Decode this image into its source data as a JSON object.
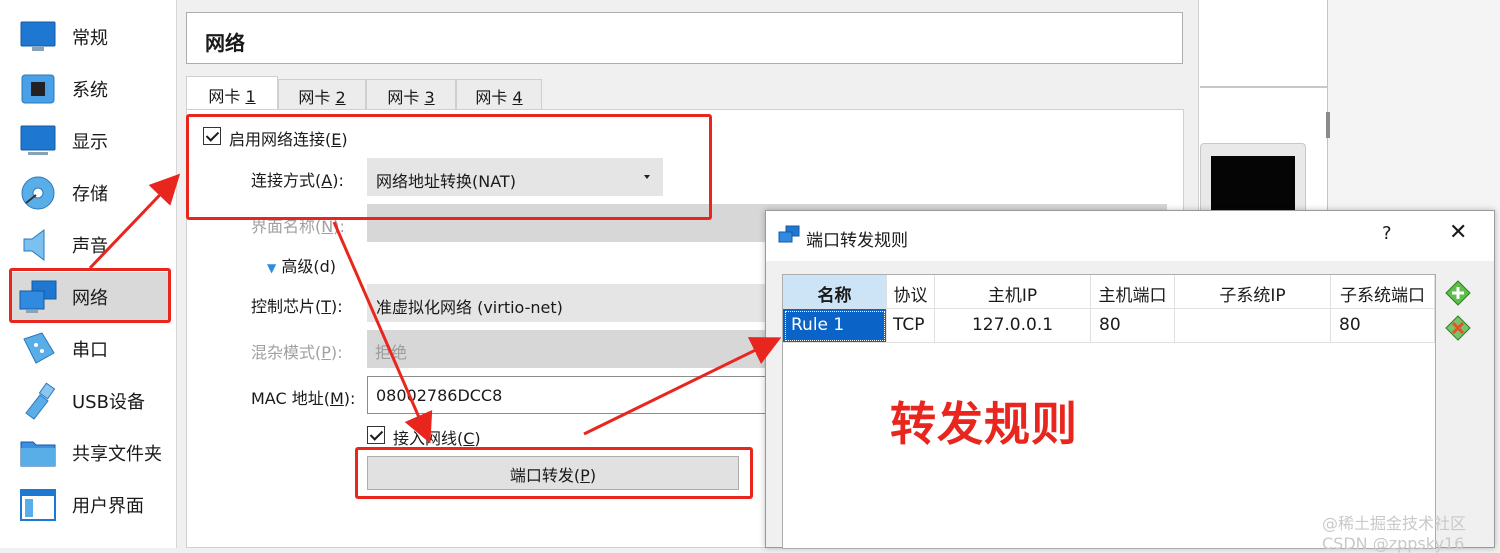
{
  "sidebar": {
    "items": [
      {
        "label": "常规",
        "icon": "general-monitor-icon"
      },
      {
        "label": "系统",
        "icon": "system-chip-icon"
      },
      {
        "label": "显示",
        "icon": "display-monitor-icon"
      },
      {
        "label": "存储",
        "icon": "storage-disk-icon"
      },
      {
        "label": "声音",
        "icon": "speaker-icon"
      },
      {
        "label": "网络",
        "icon": "network-icon",
        "selected": true
      },
      {
        "label": "串口",
        "icon": "serial-port-icon"
      },
      {
        "label": "USB设备",
        "icon": "usb-icon"
      },
      {
        "label": "共享文件夹",
        "icon": "shared-folder-icon"
      },
      {
        "label": "用户界面",
        "icon": "user-interface-icon"
      }
    ]
  },
  "panel": {
    "section_title": "网络",
    "tabs": [
      {
        "prefix": "网卡 ",
        "num": "1",
        "active": true
      },
      {
        "prefix": "网卡 ",
        "num": "2"
      },
      {
        "prefix": "网卡 ",
        "num": "3"
      },
      {
        "prefix": "网卡 ",
        "num": "4"
      }
    ],
    "enable_network": {
      "label": "启用网络连接(",
      "mnemonic": "E",
      "suffix": ")",
      "checked": true
    },
    "attached_to": {
      "label": "连接方式(",
      "mnemonic": "A",
      "suffix": "):",
      "value": "网络地址转换(NAT)"
    },
    "interface_name": {
      "label": "界面名称(",
      "mnemonic": "N",
      "suffix": "):"
    },
    "advanced": {
      "label": "高级(d)"
    },
    "adapter_type": {
      "label": "控制芯片(",
      "mnemonic": "T",
      "suffix": "):",
      "value": "准虚拟化网络 (virtio-net)"
    },
    "promiscuous": {
      "label": "混杂模式(",
      "mnemonic": "P",
      "suffix": "):",
      "value": "拒绝"
    },
    "mac": {
      "label": "MAC 地址(",
      "mnemonic": "M",
      "suffix": "):",
      "value": "08002786DCC8"
    },
    "cable_connected": {
      "label": "接入网线(",
      "mnemonic": "C",
      "suffix": ")",
      "checked": true
    },
    "port_forward_button": {
      "label": "端口转发(",
      "mnemonic": "P",
      "suffix": ")"
    }
  },
  "dialog": {
    "title": "端口转发规则",
    "help": "?",
    "close": "✕",
    "columns": [
      "名称",
      "协议",
      "主机IP",
      "主机端口",
      "子系统IP",
      "子系统端口"
    ],
    "rows": [
      {
        "name": "Rule 1",
        "protocol": "TCP",
        "host_ip": "127.0.0.1",
        "host_port": "80",
        "guest_ip": "",
        "guest_port": "80"
      }
    ]
  },
  "annotation": {
    "text": "转发规则"
  },
  "watermark": "@稀土掘金技术社区 CSDN @zppsky16",
  "colors": {
    "annotation_red": "#e8261e",
    "selection_blue": "#0a64c8",
    "sorted_header": "#cde4f7"
  }
}
